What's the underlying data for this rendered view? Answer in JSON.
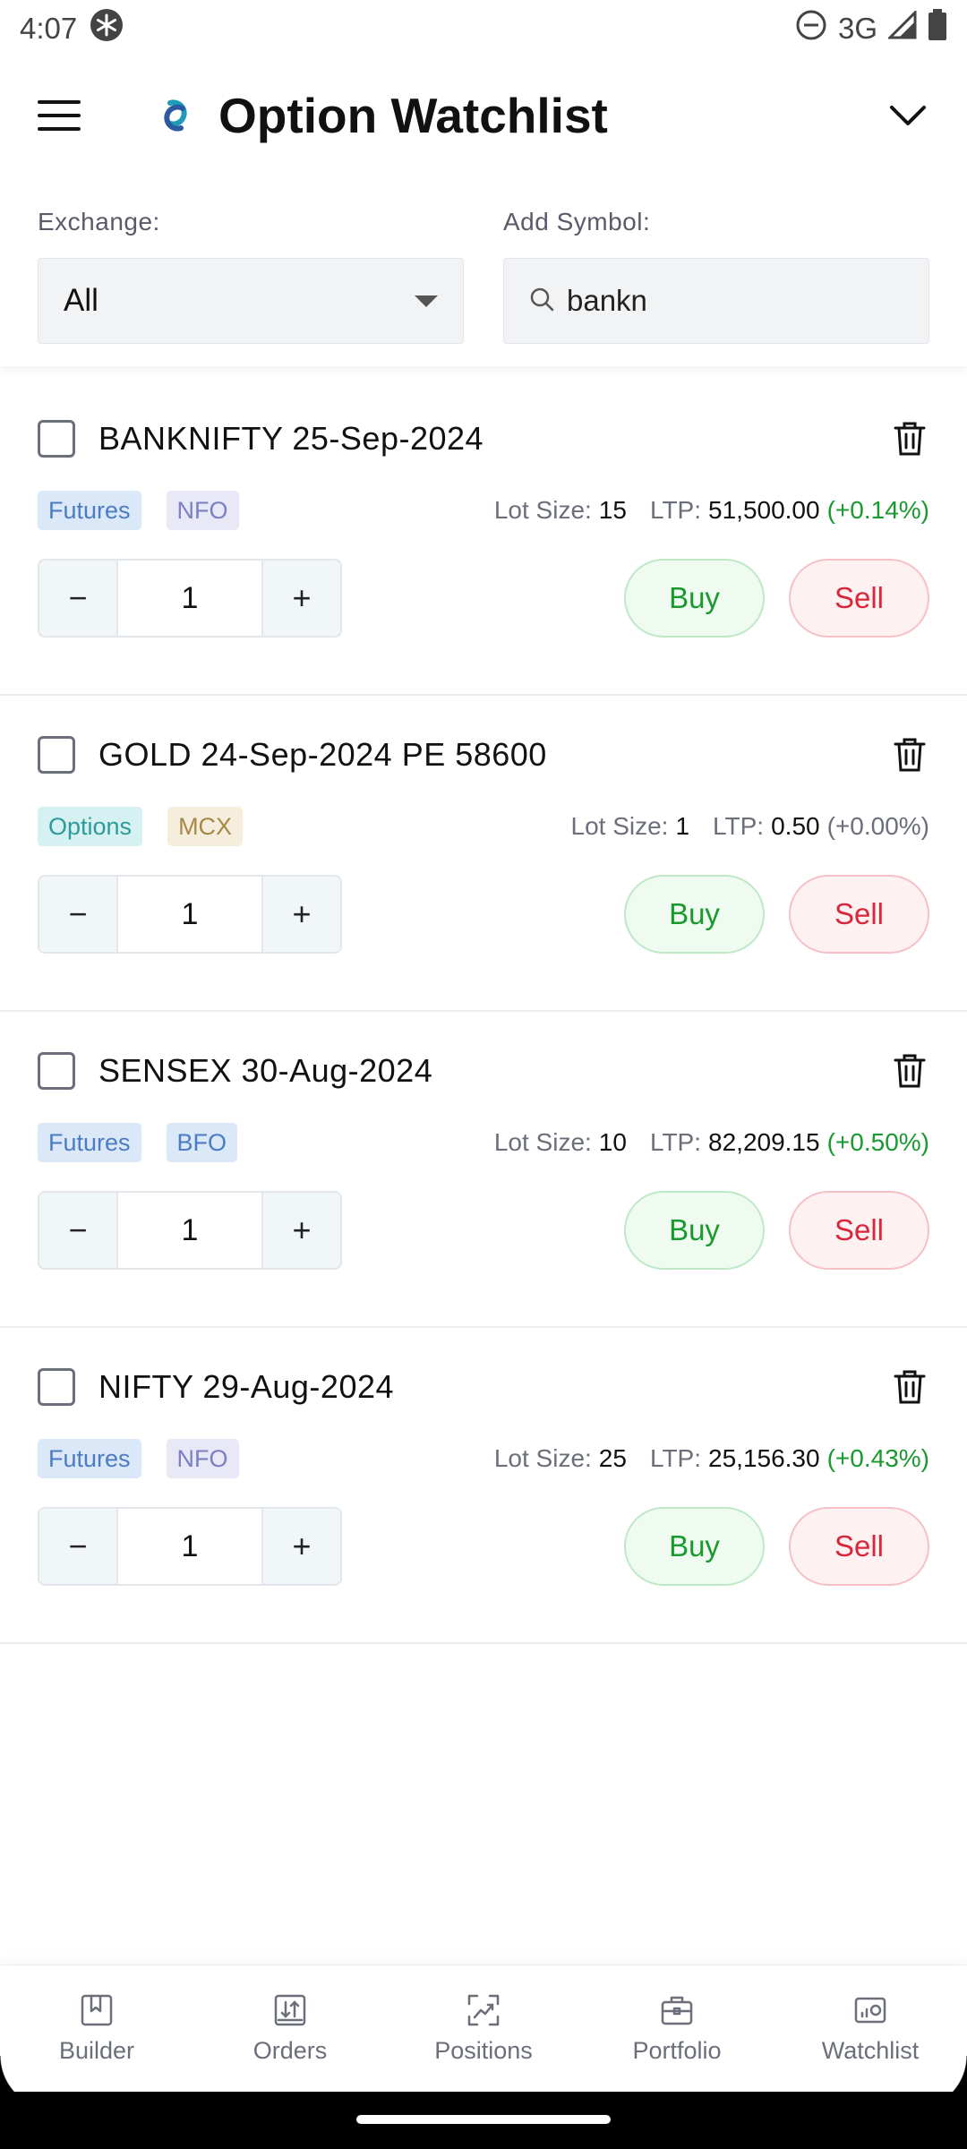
{
  "status_bar": {
    "time": "4:07",
    "network": "3G"
  },
  "header": {
    "title": "Option Watchlist"
  },
  "filters": {
    "exchange_label": "Exchange:",
    "exchange_value": "All",
    "symbol_label": "Add Symbol:",
    "symbol_value": "bankn"
  },
  "watchlist": {
    "lot_size_label": "Lot Size:",
    "ltp_label": "LTP:",
    "items": [
      {
        "name": "BANKNIFTY 25-Sep-2024",
        "type": "Futures",
        "exchange": "NFO",
        "lot_size": "15",
        "ltp": "51,500.00",
        "change": "(+0.14%)",
        "qty": "1",
        "buy": "Buy",
        "sell": "Sell"
      },
      {
        "name": "GOLD 24-Sep-2024 PE 58600",
        "type": "Options",
        "exchange": "MCX",
        "lot_size": "1",
        "ltp": "0.50",
        "change": "(+0.00%)",
        "qty": "1",
        "buy": "Buy",
        "sell": "Sell"
      },
      {
        "name": "SENSEX 30-Aug-2024",
        "type": "Futures",
        "exchange": "BFO",
        "lot_size": "10",
        "ltp": "82,209.15",
        "change": "(+0.50%)",
        "qty": "1",
        "buy": "Buy",
        "sell": "Sell"
      },
      {
        "name": "NIFTY 29-Aug-2024",
        "type": "Futures",
        "exchange": "NFO",
        "lot_size": "25",
        "ltp": "25,156.30",
        "change": "(+0.43%)",
        "qty": "1",
        "buy": "Buy",
        "sell": "Sell"
      }
    ]
  },
  "bottom_nav": {
    "items": [
      {
        "label": "Builder",
        "icon": "bookmark-book-icon"
      },
      {
        "label": "Orders",
        "icon": "orders-book-icon"
      },
      {
        "label": "Positions",
        "icon": "trend-chart-icon"
      },
      {
        "label": "Portfolio",
        "icon": "briefcase-icon"
      },
      {
        "label": "Watchlist",
        "icon": "watchlist-icon"
      }
    ]
  },
  "colors": {
    "buy": "#1a9a2e",
    "sell": "#d9263a",
    "accent": "#1e9bb8"
  }
}
